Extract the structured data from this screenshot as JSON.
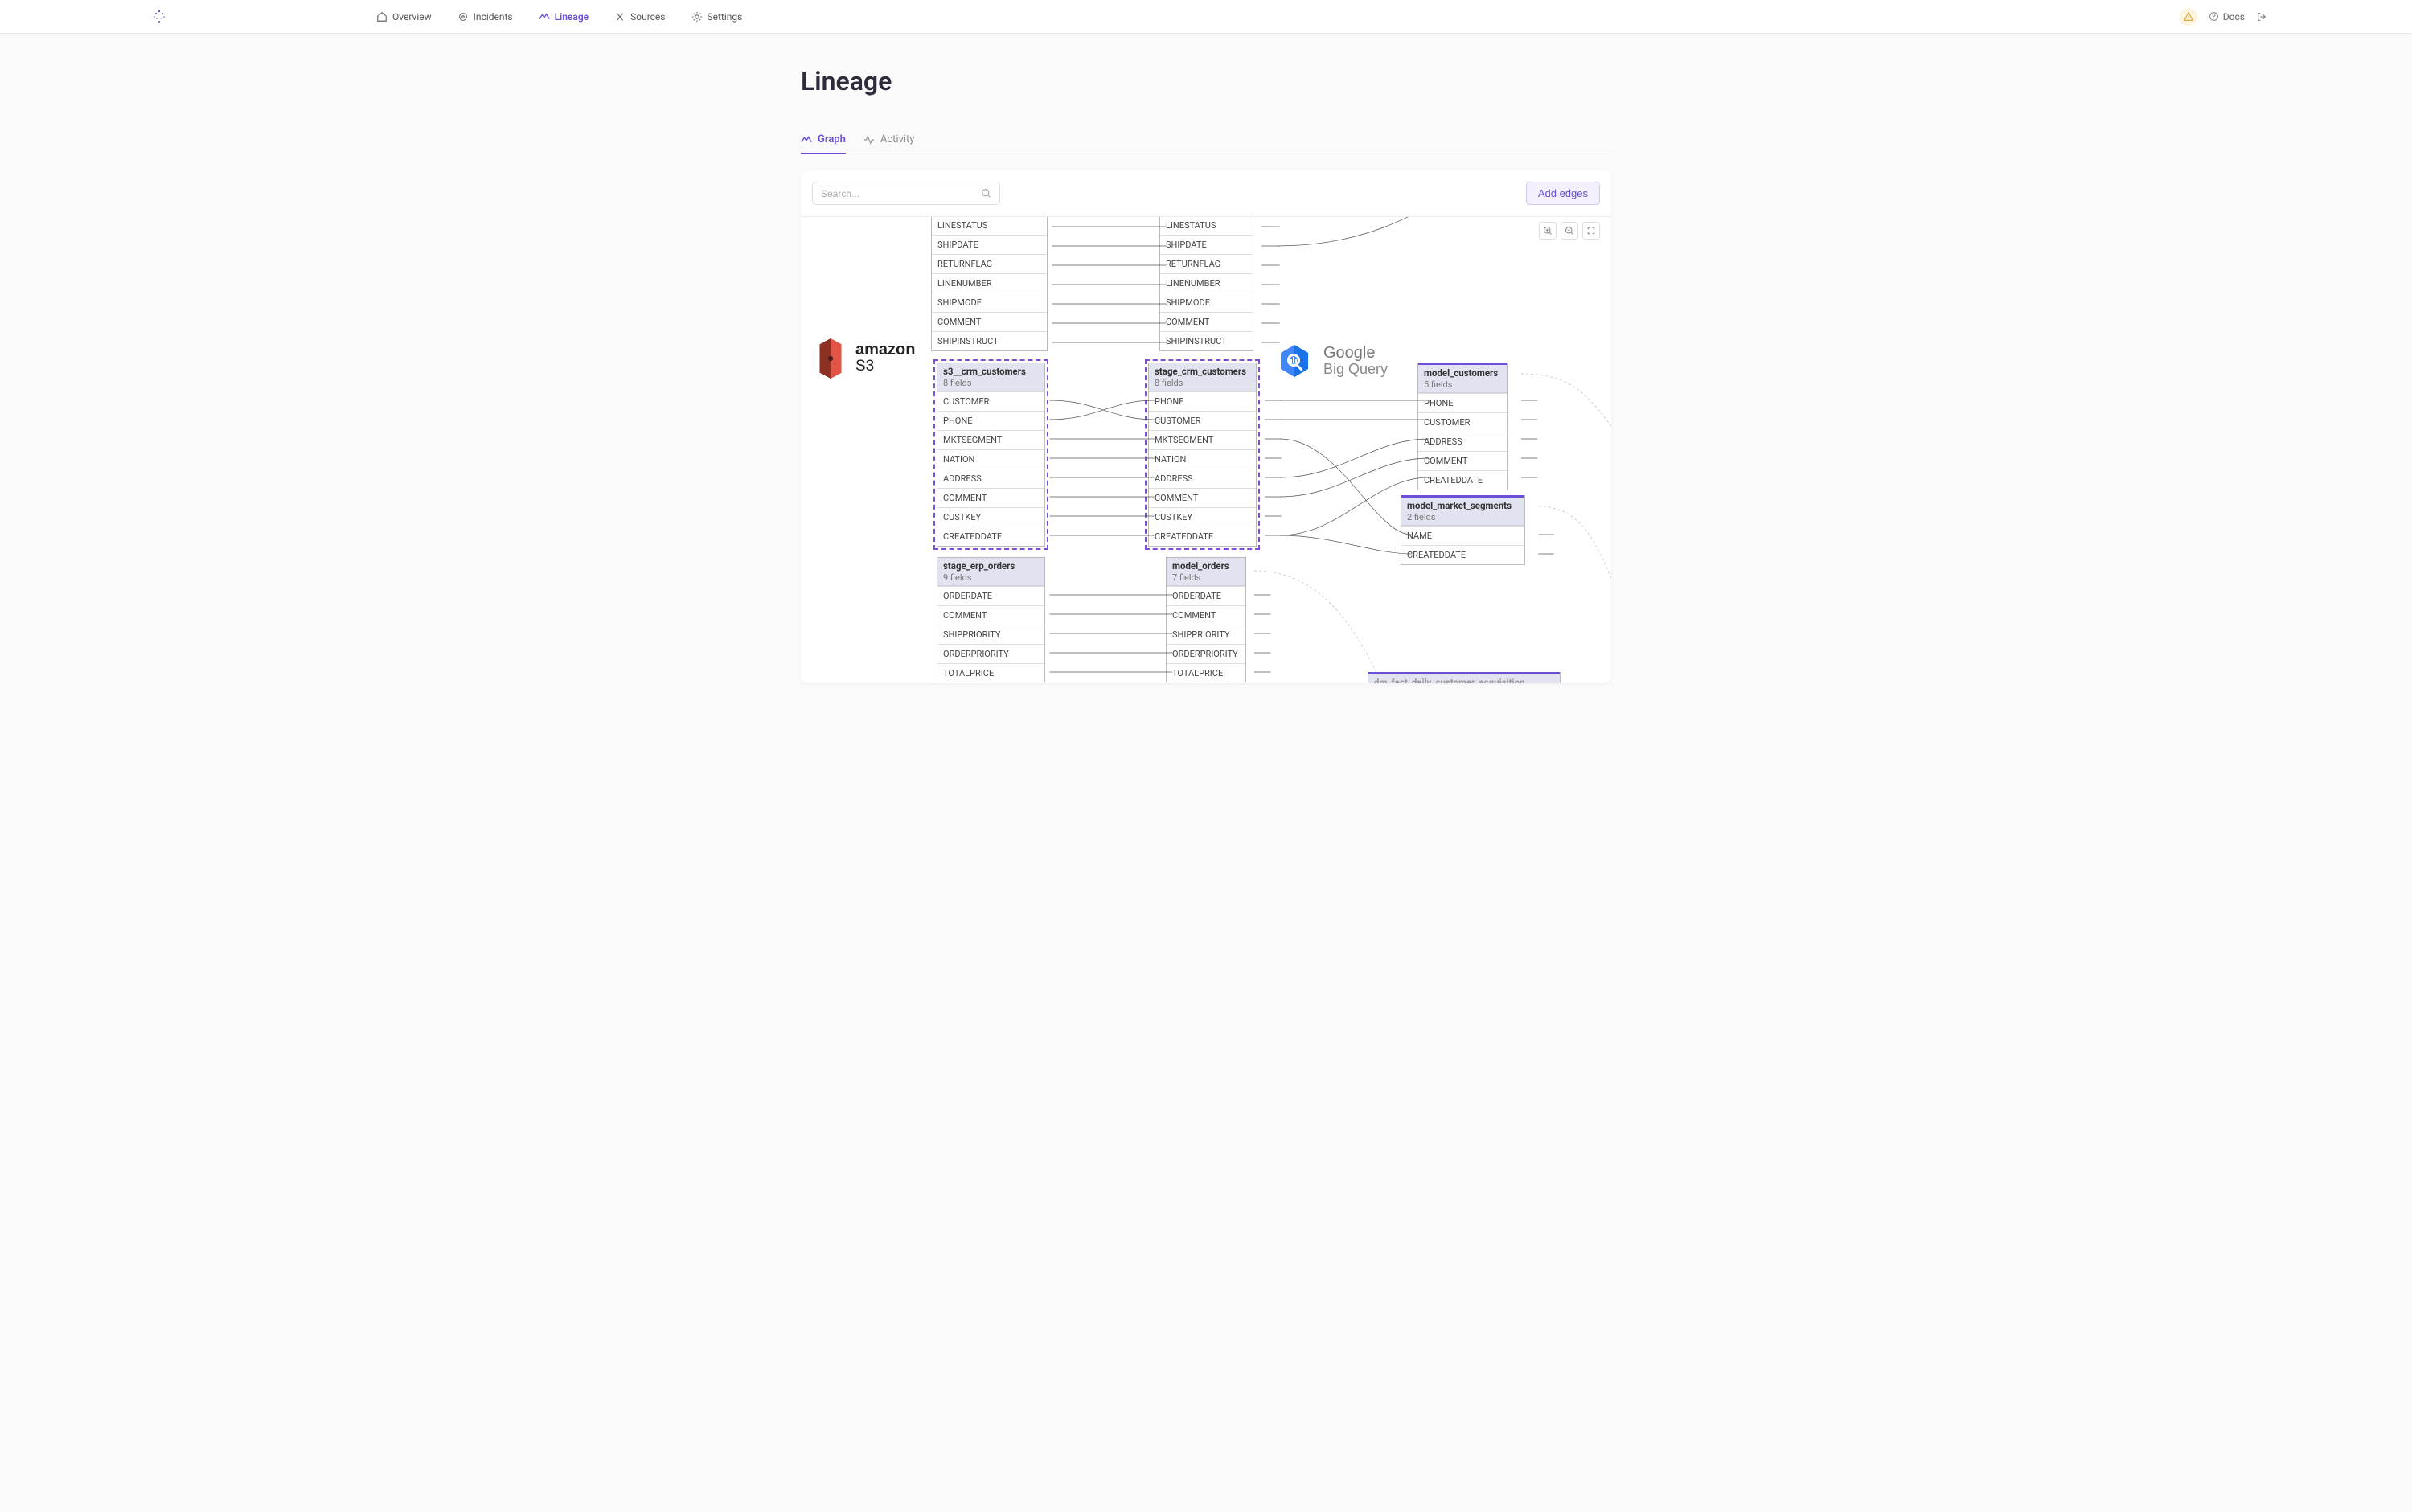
{
  "header": {
    "nav": {
      "overview": "Overview",
      "incidents": "Incidents",
      "lineage": "Lineage",
      "sources": "Sources",
      "settings": "Settings"
    },
    "docs": "Docs"
  },
  "page": {
    "title": "Lineage"
  },
  "tabs": {
    "graph": "Graph",
    "activity": "Activity"
  },
  "toolbar": {
    "search_placeholder": "Search...",
    "add_edges": "Add edges"
  },
  "source_logos": {
    "s3_brand": "amazon",
    "s3_sub": "S3",
    "bq_brand": "Google",
    "bq_sub": "Big Query"
  },
  "nodes": {
    "top_left": {
      "fields": [
        "LINESTATUS",
        "SHIPDATE",
        "RETURNFLAG",
        "LINENUMBER",
        "SHIPMODE",
        "COMMENT",
        "SHIPINSTRUCT"
      ]
    },
    "top_right": {
      "fields": [
        "LINESTATUS",
        "SHIPDATE",
        "RETURNFLAG",
        "LINENUMBER",
        "SHIPMODE",
        "COMMENT",
        "SHIPINSTRUCT"
      ]
    },
    "s3_crm": {
      "title": "s3__crm_customers",
      "sub": "8 fields",
      "fields": [
        "CUSTOMER",
        "PHONE",
        "MKTSEGMENT",
        "NATION",
        "ADDRESS",
        "COMMENT",
        "CUSTKEY",
        "CREATEDDATE"
      ]
    },
    "stage_crm": {
      "title": "stage_crm_customers",
      "sub": "8 fields",
      "fields": [
        "PHONE",
        "CUSTOMER",
        "MKTSEGMENT",
        "NATION",
        "ADDRESS",
        "COMMENT",
        "CUSTKEY",
        "CREATEDDATE"
      ]
    },
    "stage_erp_orders": {
      "title": "stage_erp_orders",
      "sub": "9 fields",
      "fields": [
        "ORDERDATE",
        "COMMENT",
        "SHIPPRIORITY",
        "ORDERPRIORITY",
        "TOTALPRICE"
      ]
    },
    "model_orders": {
      "title": "model_orders",
      "sub": "7 fields",
      "fields": [
        "ORDERDATE",
        "COMMENT",
        "SHIPPRIORITY",
        "ORDERPRIORITY",
        "TOTALPRICE"
      ]
    },
    "model_customers": {
      "title": "model_customers",
      "sub": "5 fields",
      "fields": [
        "PHONE",
        "CUSTOMER",
        "ADDRESS",
        "COMMENT",
        "CREATEDDATE"
      ]
    },
    "model_market_segments": {
      "title": "model_market_segments",
      "sub": "2 fields",
      "fields": [
        "NAME",
        "CREATEDDATE"
      ]
    },
    "bottom_partial_title": "dm_fact_daily_customer_acquisition"
  }
}
